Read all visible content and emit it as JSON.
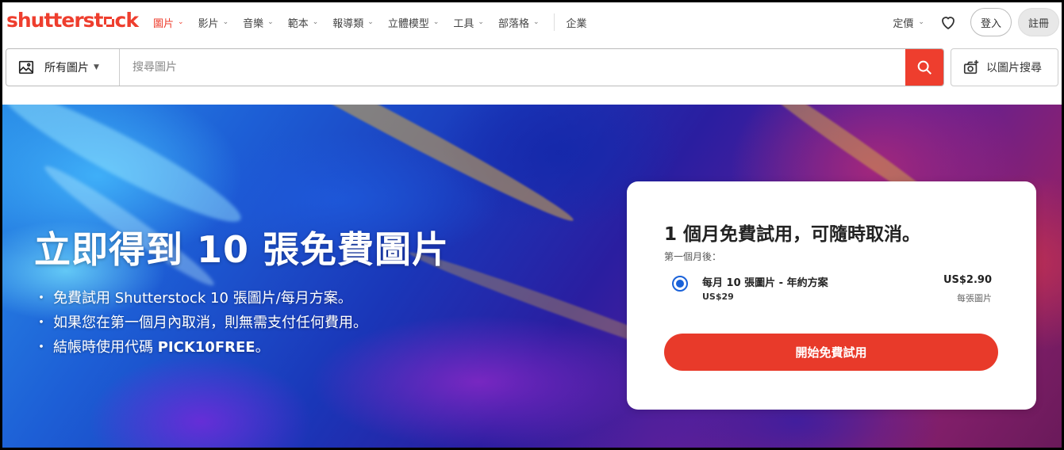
{
  "brand": {
    "logo_left": "shutterst",
    "logo_right": "ck",
    "accent": "#ee3e2e"
  },
  "nav": {
    "items": [
      {
        "label": "圖片",
        "active": true
      },
      {
        "label": "影片"
      },
      {
        "label": "音樂"
      },
      {
        "label": "範本"
      },
      {
        "label": "報導類"
      },
      {
        "label": "立體模型"
      },
      {
        "label": "工具"
      },
      {
        "label": "部落格"
      }
    ],
    "enterprise": "企業",
    "pricing": "定價",
    "login": "登入",
    "signup": "註冊"
  },
  "search": {
    "category": "所有圖片",
    "placeholder": "搜尋圖片",
    "image_search": "以圖片搜尋"
  },
  "hero": {
    "title": "立即得到 10 張免費圖片",
    "bullets": {
      "b1": "免費試用 Shutterstock 10 張圖片/每月方案。",
      "b2": "如果您在第一個月內取消，則無需支付任何費用。",
      "b3_prefix": "結帳時使用代碼 ",
      "b3_code": "PICK10FREE",
      "b3_suffix": "。"
    },
    "bullet_mark": "・"
  },
  "offer": {
    "title": "1 個月免費試用，可隨時取消。",
    "subtitle": "第一個月後：",
    "plan_name": "每月 10 張圖片 - 年約方案",
    "plan_price": "US$29",
    "unit_price": "US$2.90",
    "unit_label": "每張圖片",
    "cta": "開始免費試用",
    "cta_color": "#e83a2a",
    "radio_color": "#1a62d9"
  }
}
